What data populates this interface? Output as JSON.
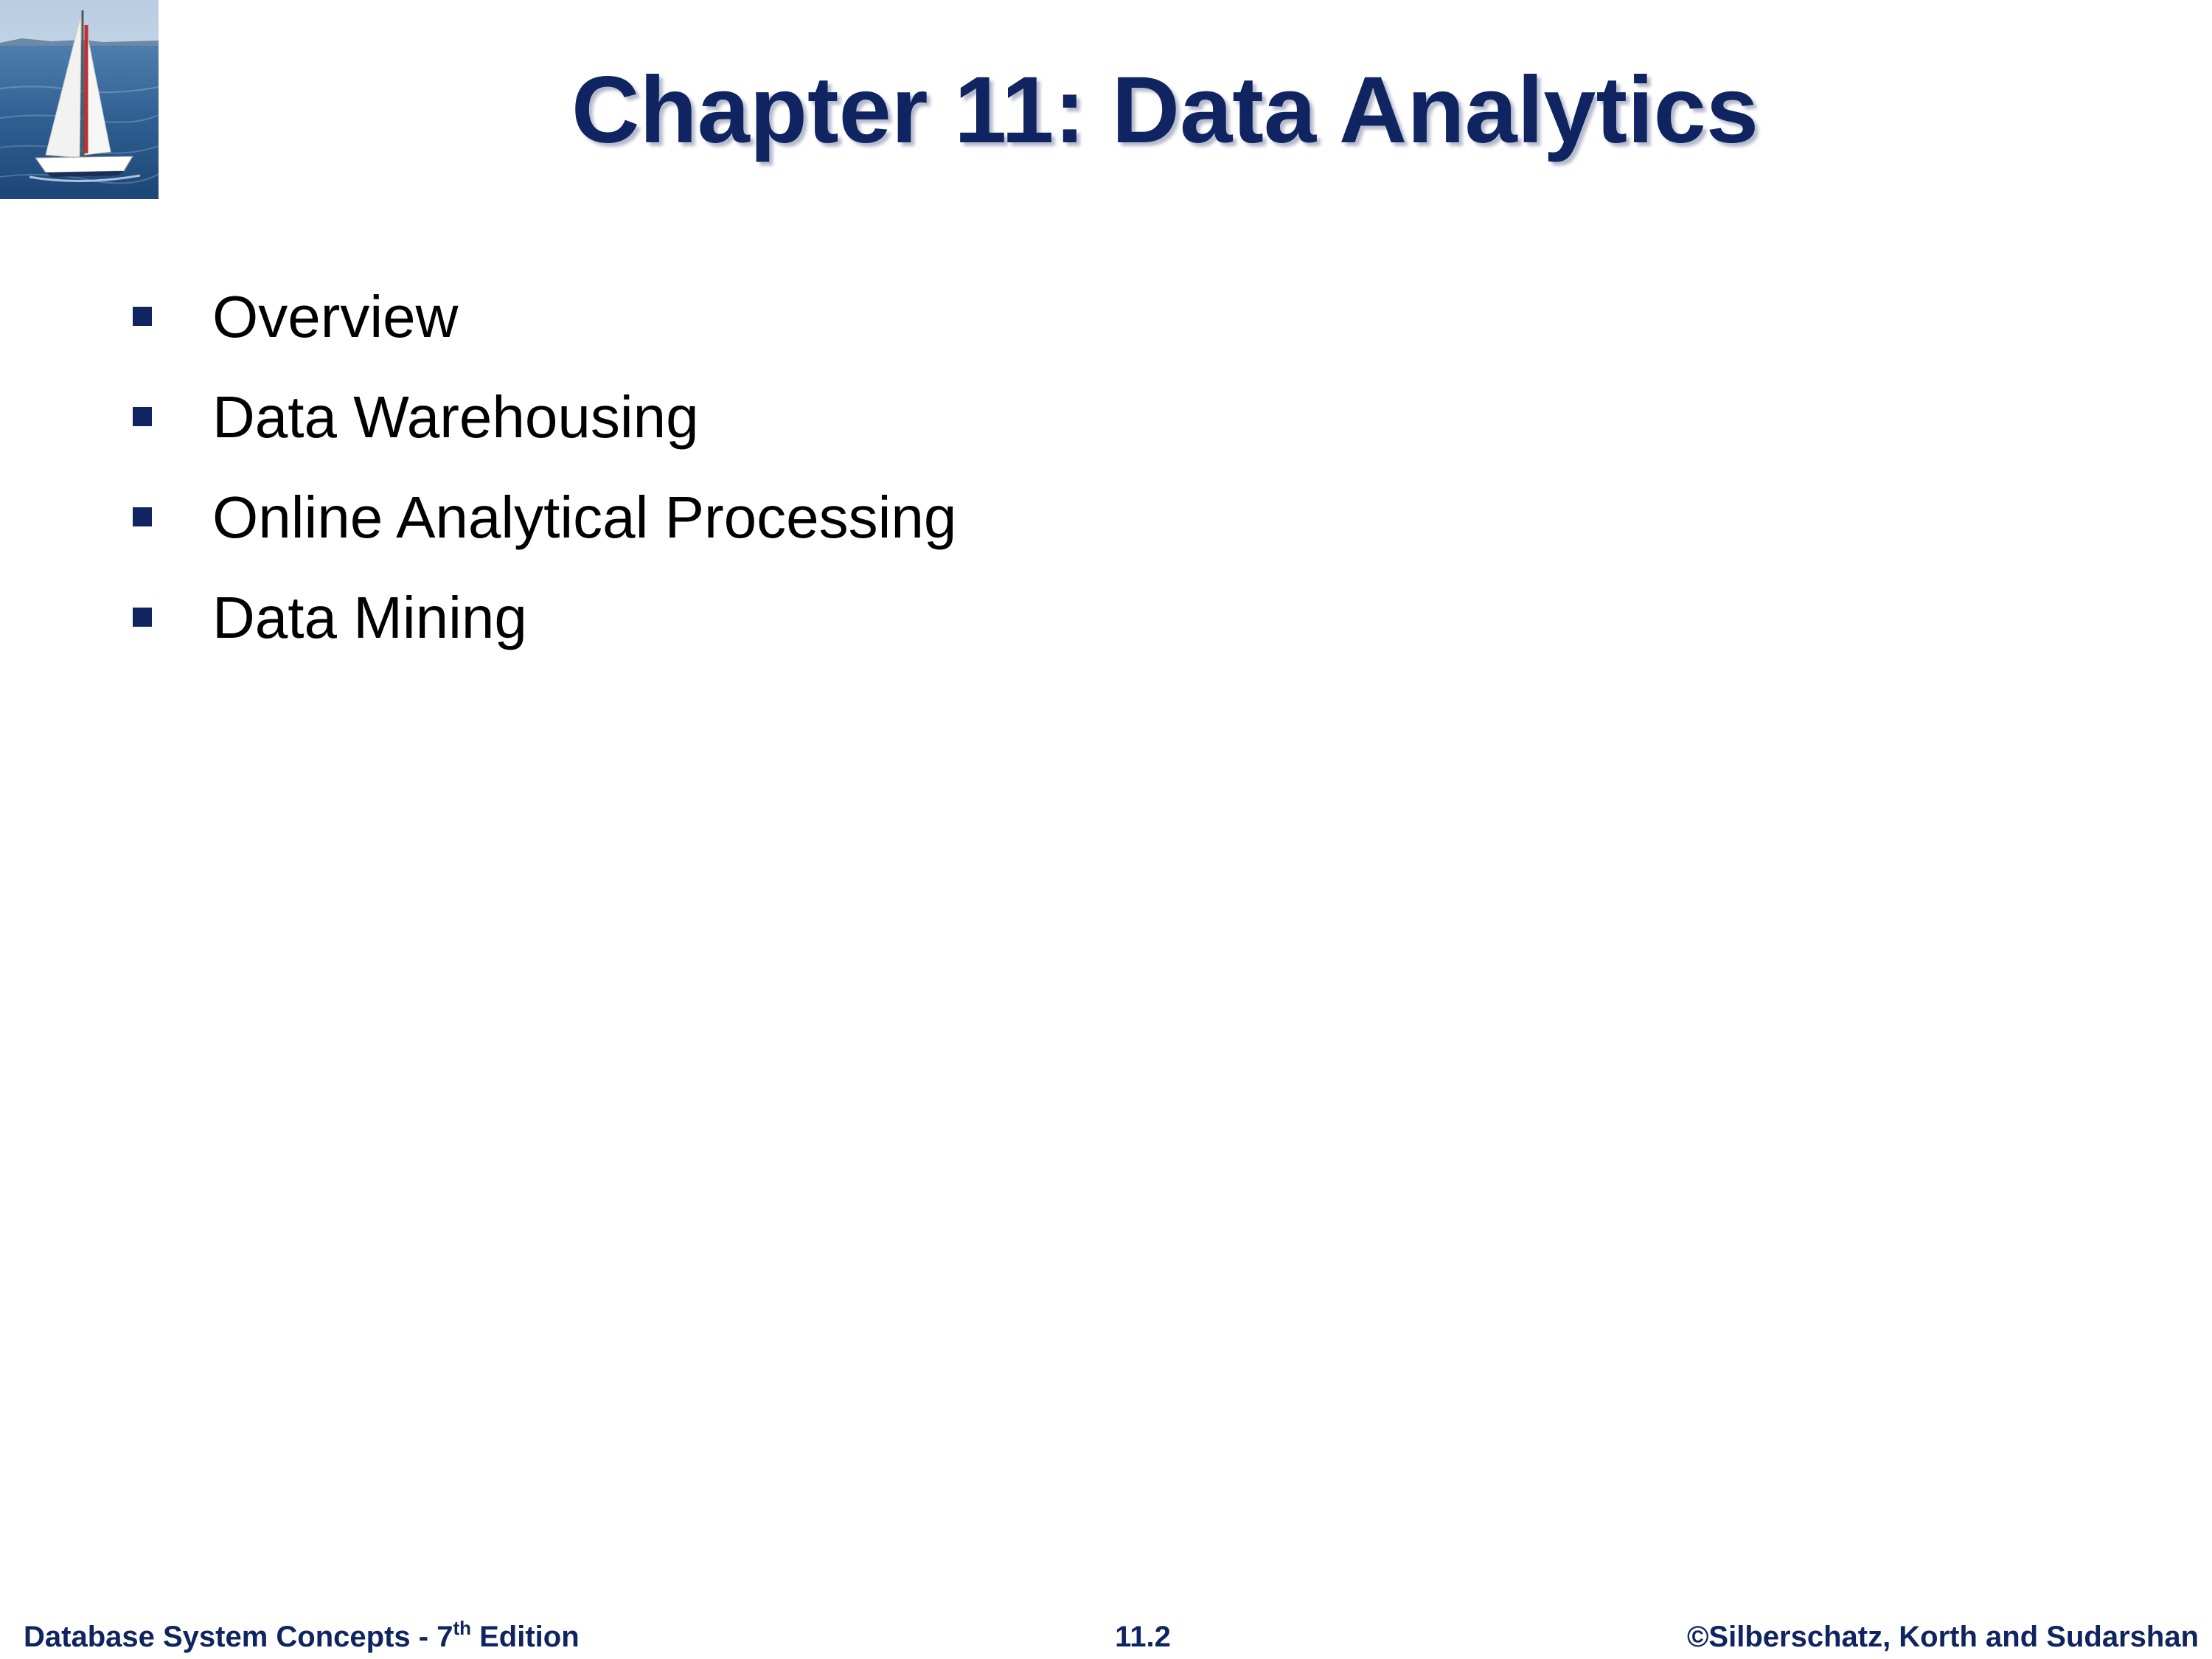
{
  "slide": {
    "title": "Chapter 11: Data Analytics",
    "bullets": [
      "Overview",
      "Data Warehousing",
      "Online Analytical Processing",
      "Data Mining"
    ]
  },
  "footer": {
    "left_prefix": "Database System Concepts - 7",
    "left_sup": "th",
    "left_suffix": " Edition",
    "page_number": "11.2",
    "copyright": "©Silberschatz, Korth and Sudarshan"
  },
  "colors": {
    "title": "#0f2460",
    "bullet": "#0f2460",
    "body_text": "#000000",
    "footer": "#0f2460"
  },
  "icons": {
    "logo": "sailboat-logo-icon",
    "bullet": "square-bullet-icon"
  }
}
